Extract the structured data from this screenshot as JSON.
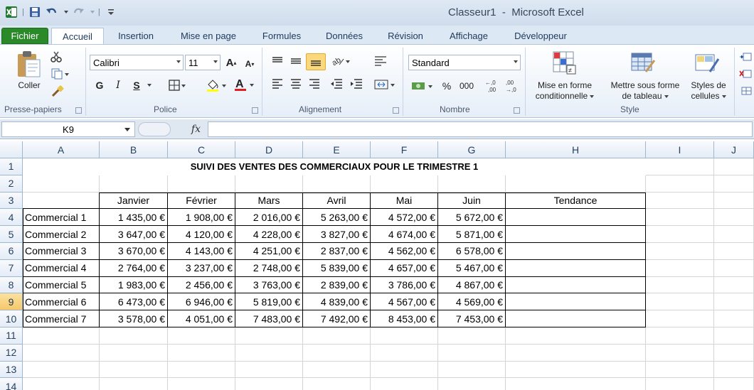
{
  "window": {
    "title": "Classeur1  -  Microsoft Excel",
    "app_icon": "excel-icon",
    "qat_separator": "|"
  },
  "tabs": [
    {
      "label": "Fichier",
      "x": 0
    },
    {
      "label": "Accueil"
    },
    {
      "label": "Insertion"
    },
    {
      "label": "Mise en page"
    },
    {
      "label": "Formules"
    },
    {
      "label": "Données"
    },
    {
      "label": "Révision"
    },
    {
      "label": "Affichage"
    },
    {
      "label": "Développeur"
    }
  ],
  "ribbon": {
    "clipboard": {
      "paste_label": "Coller",
      "group_label": "Presse-papiers"
    },
    "font": {
      "font_name": "Calibri",
      "font_size": "11",
      "bold": "G",
      "italic": "I",
      "underline": "S",
      "group_label": "Police"
    },
    "alignment": {
      "group_label": "Alignement"
    },
    "number": {
      "format": "Standard",
      "percent": "%",
      "thousands": "000",
      "group_label": "Nombre"
    },
    "style": {
      "conditional_line1": "Mise en forme",
      "conditional_line2": "conditionnelle",
      "table_line1": "Mettre sous forme",
      "table_line2": "de tableau",
      "cellstyles_line1": "Styles de",
      "cellstyles_line2": "cellules",
      "group_label": "Style"
    }
  },
  "formula_bar": {
    "name_box": "K9",
    "fx": "fx",
    "value": ""
  },
  "sheet": {
    "columns": [
      "A",
      "B",
      "C",
      "D",
      "E",
      "F",
      "G",
      "H",
      "I",
      "J"
    ],
    "rows": [
      "1",
      "2",
      "3",
      "4",
      "5",
      "6",
      "7",
      "8",
      "9",
      "10",
      "11",
      "12",
      "13",
      "14"
    ],
    "selected_row": "9",
    "title": "SUIVI DES VENTES DES COMMERCIAUX POUR LE TRIMESTRE 1",
    "headers": [
      "Janvier",
      "Février",
      "Mars",
      "Avril",
      "Mai",
      "Juin",
      "Tendance"
    ],
    "data": [
      {
        "name": "Commercial 1",
        "values": [
          "1 435,00 €",
          "1 908,00 €",
          "2 016,00 €",
          "5 263,00 €",
          "4 572,00 €",
          "5 672,00 €"
        ]
      },
      {
        "name": "Commercial 2",
        "values": [
          "3 647,00 €",
          "4 120,00 €",
          "4 228,00 €",
          "3 827,00 €",
          "4 674,00 €",
          "5 871,00 €"
        ]
      },
      {
        "name": "Commercial 3",
        "values": [
          "3 670,00 €",
          "4 143,00 €",
          "4 251,00 €",
          "2 837,00 €",
          "4 562,00 €",
          "6 578,00 €"
        ]
      },
      {
        "name": "Commercial 4",
        "values": [
          "2 764,00 €",
          "3 237,00 €",
          "2 748,00 €",
          "5 839,00 €",
          "4 657,00 €",
          "5 467,00 €"
        ]
      },
      {
        "name": "Commercial 5",
        "values": [
          "1 983,00 €",
          "2 456,00 €",
          "3 763,00 €",
          "2 839,00 €",
          "3 786,00 €",
          "4 867,00 €"
        ]
      },
      {
        "name": "Commercial 6",
        "values": [
          "6 473,00 €",
          "6 946,00 €",
          "5 819,00 €",
          "4 839,00 €",
          "4 567,00 €",
          "4 569,00 €"
        ]
      },
      {
        "name": "Commercial 7",
        "values": [
          "3 578,00 €",
          "4 051,00 €",
          "7 483,00 €",
          "7 492,00 €",
          "8 453,00 €",
          "7 453,00 €"
        ]
      }
    ]
  },
  "colors": {
    "file_tab": "#2a8a2a",
    "selected_header": "#f6c86a",
    "active_align": "#fbd87a"
  }
}
